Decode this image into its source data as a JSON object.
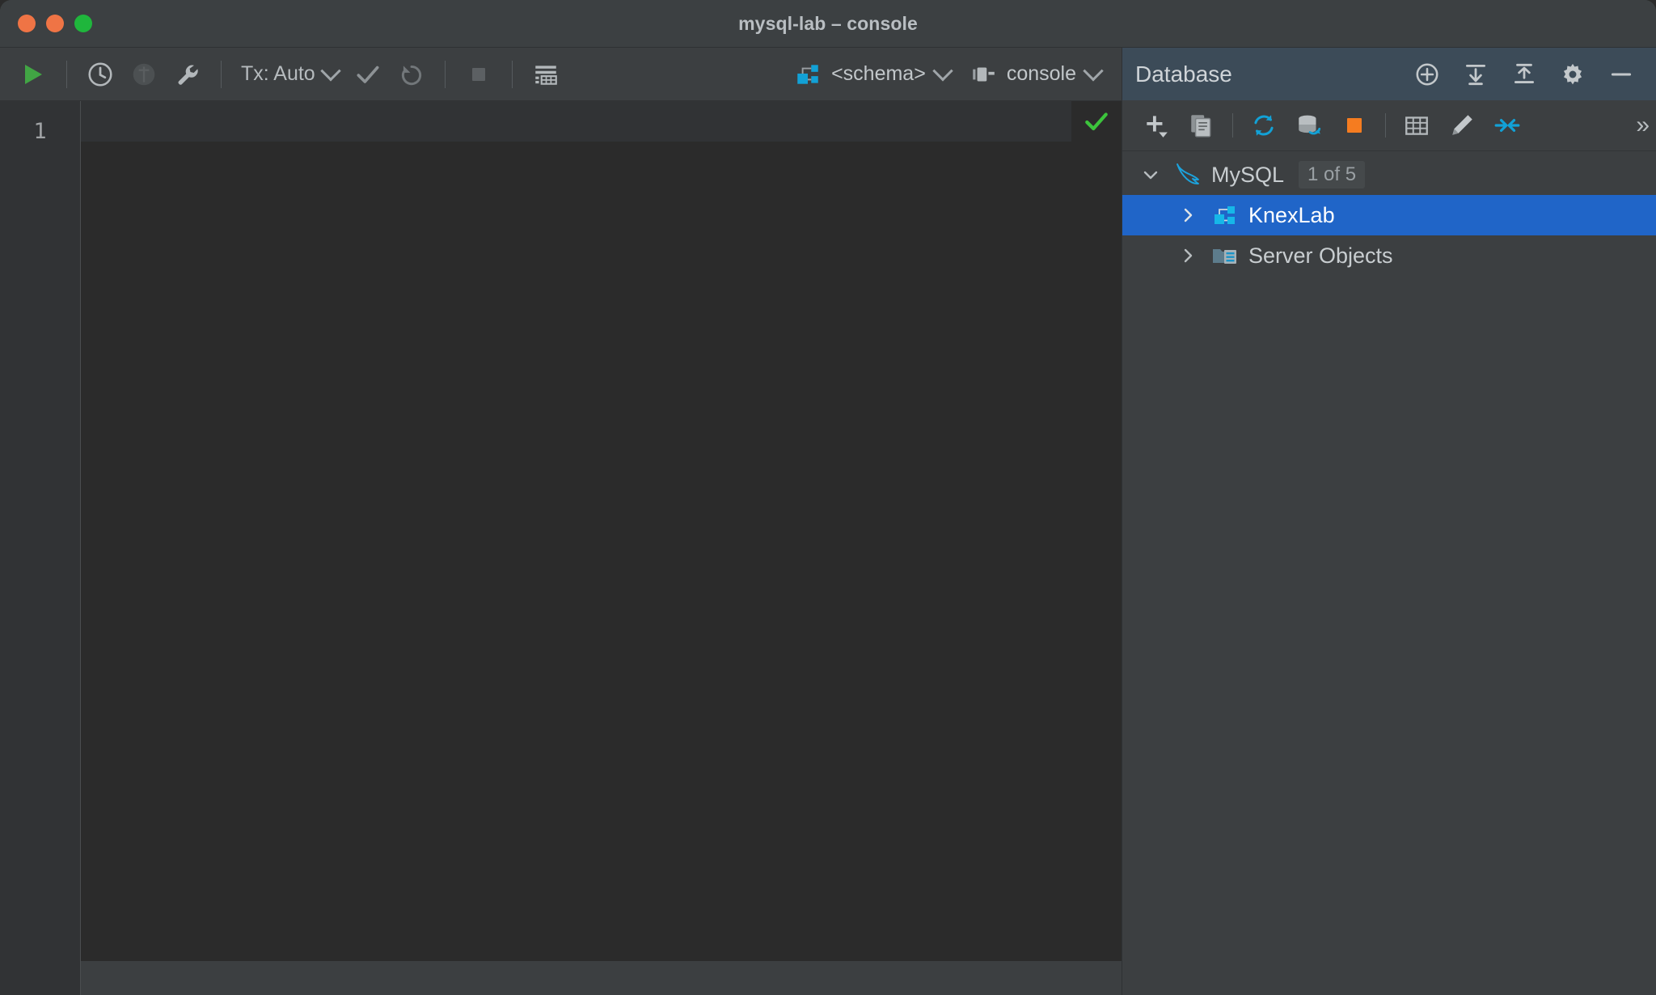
{
  "window": {
    "title": "mysql-lab – console",
    "traffic_lights": [
      "close",
      "minimize",
      "zoom"
    ]
  },
  "console_toolbar": {
    "buttons": [
      {
        "name": "execute-button",
        "icon": "play-icon",
        "label": "Execute"
      },
      {
        "name": "history-button",
        "icon": "clock-icon",
        "label": "History"
      },
      {
        "name": "data-source-properties-button",
        "icon": "disabled-circle-icon",
        "label": "Data Source Properties"
      },
      {
        "name": "settings-wrench-button",
        "icon": "wrench-icon",
        "label": "Settings"
      }
    ],
    "transaction": {
      "label": "Tx: Auto",
      "chevron": "chevron-down-icon"
    },
    "commit_label": "Commit",
    "rollback_label": "Rollback",
    "stop_label": "Stop",
    "table_view_label": "Table View",
    "schema_selector": {
      "icon": "schema-icon",
      "value": "<schema>",
      "chevron": "chevron-down-icon"
    },
    "session_selector": {
      "icon": "console-session-icon",
      "value": "console",
      "chevron": "chevron-down-icon"
    }
  },
  "editor": {
    "line_numbers": [
      "1"
    ],
    "content": "",
    "inspection_icon": "green-check-icon",
    "inspection_status": "No problems found"
  },
  "database_panel": {
    "title": "Database",
    "header_buttons": [
      {
        "name": "add-data-source-button",
        "icon": "plus-circle-icon"
      },
      {
        "name": "expand-all-button",
        "icon": "expand-all-icon"
      },
      {
        "name": "collapse-all-button",
        "icon": "collapse-all-icon"
      },
      {
        "name": "settings-button",
        "icon": "gear-icon"
      },
      {
        "name": "hide-button",
        "icon": "minimize-icon"
      }
    ],
    "toolbar_buttons": [
      {
        "name": "new-button",
        "icon": "plus-dropdown-icon"
      },
      {
        "name": "duplicate-button",
        "icon": "copy-icon"
      },
      {
        "name": "refresh-button",
        "icon": "refresh-icon"
      },
      {
        "name": "synchronize-button",
        "icon": "db-sync-icon"
      },
      {
        "name": "stop-button",
        "icon": "orange-stop-icon"
      },
      {
        "name": "open-table-button",
        "icon": "table-icon"
      },
      {
        "name": "edit-data-button",
        "icon": "pencil-icon"
      },
      {
        "name": "jump-to-editor-button",
        "icon": "jump-arrows-icon"
      },
      {
        "name": "more-button",
        "icon": "chevron-double-right-icon",
        "glyph": "»"
      }
    ],
    "tree": [
      {
        "name": "mysql-data-source",
        "label": "MySQL",
        "icon": "mysql-dolphin-icon",
        "arrow": "chevron-down-icon",
        "expanded": true,
        "badge": "1 of 5",
        "depth": 0,
        "selected": false
      },
      {
        "name": "knexlab-schema",
        "label": "KnexLab",
        "icon": "schema-icon",
        "arrow": "chevron-right-icon",
        "expanded": false,
        "badge": "",
        "depth": 1,
        "selected": true
      },
      {
        "name": "server-objects-node",
        "label": "Server Objects",
        "icon": "server-objects-icon",
        "arrow": "chevron-right-icon",
        "expanded": false,
        "badge": "",
        "depth": 1,
        "selected": false
      }
    ]
  },
  "colors": {
    "window_chrome": "#3c4042",
    "toolbar_bg": "#3c3f41",
    "editor_bg": "#2b2b2b",
    "gutter_bg": "#313335",
    "db_header_bg": "#3c4b58",
    "selection_blue": "#2065c8",
    "accent_blue": "#12a1d6",
    "play_green": "#4fa84f",
    "check_green": "#3cc43c",
    "stop_orange": "#f57c20",
    "text_primary": "#c8cdd0",
    "text_muted": "#9aa0a4"
  }
}
